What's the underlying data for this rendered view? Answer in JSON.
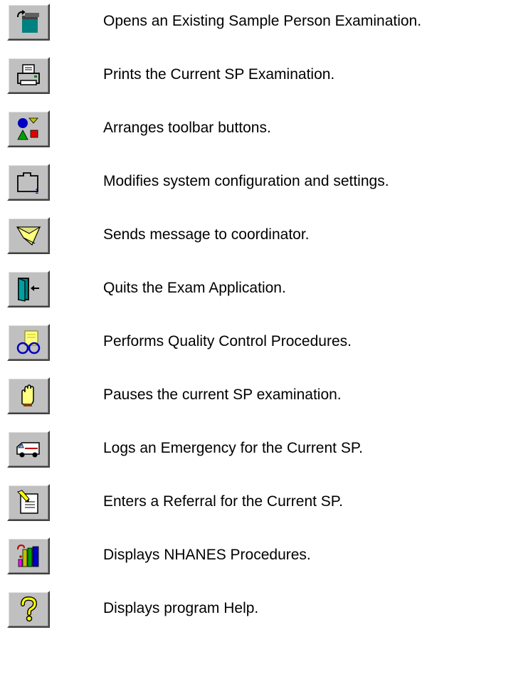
{
  "toolbar_buttons": [
    {
      "icon": "open-exam-icon",
      "description": "Opens an Existing Sample Person Examination."
    },
    {
      "icon": "printer-icon",
      "description": "Prints the Current SP Examination."
    },
    {
      "icon": "arrange-shapes-icon",
      "description": "Arranges toolbar buttons."
    },
    {
      "icon": "folder-config-icon",
      "description": "Modifies system configuration and settings."
    },
    {
      "icon": "message-envelope-icon",
      "description": "Sends message to coordinator."
    },
    {
      "icon": "exit-door-icon",
      "description": "Quits the Exam Application."
    },
    {
      "icon": "quality-control-glasses-icon",
      "description": "Performs Quality Control Procedures."
    },
    {
      "icon": "hand-stop-icon",
      "description": "Pauses the current SP examination."
    },
    {
      "icon": "ambulance-icon",
      "description": "Logs an Emergency for the Current SP."
    },
    {
      "icon": "referral-note-icon",
      "description": "Enters a Referral for the Current SP."
    },
    {
      "icon": "books-icon",
      "description": "Displays NHANES Procedures."
    },
    {
      "icon": "help-question-icon",
      "description": "Displays program Help."
    }
  ]
}
